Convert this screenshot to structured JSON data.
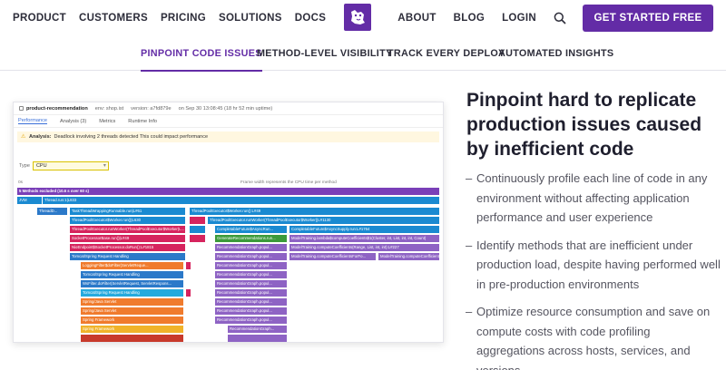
{
  "nav": {
    "left": [
      "PRODUCT",
      "CUSTOMERS",
      "PRICING",
      "SOLUTIONS",
      "DOCS"
    ],
    "right": [
      "ABOUT",
      "BLOG",
      "LOGIN"
    ],
    "cta": "GET STARTED FREE"
  },
  "tabs": [
    "PINPOINT CODE ISSUES",
    "METHOD-LEVEL VISIBILITY",
    "TRACK EVERY DEPLOY",
    "AUTOMATED INSIGHTS"
  ],
  "screenshot": {
    "service": "product-recommendation",
    "env": "env: shop.ist",
    "version": "version: a7fd879e",
    "time": "on Sep 30 13:08:45 (18 hr 52 min uptime)",
    "tabs": [
      "Performance",
      "Analysis (3)",
      "Metrics",
      "Runtime Info"
    ],
    "analysis_label": "Analysis:",
    "analysis_text": "Deadlock involving 2 threads detected This could impact performance",
    "type_label": "Type",
    "type_value": "CPU",
    "zero_label": "0s",
    "frame_note": "Frame width represents the CPU time per method",
    "frames": [
      "5 Methods excluded (10.6 s over 60 s)",
      "JVM",
      "Thread.run:1|L833",
      "ThreadD...",
      "TaskThreadWrappingRunnable.run|L#61",
      "ThreadPoolExecutor$Worker.run():L#49",
      "ThreadPoolExecutor$Worker.run()|L630",
      "ThreadPoolExecutor.runWorker(ThreadPoolExecutor$Worker)|L#1130",
      "ThreadPoolExecutor.runWorker(ThreadPoolExecutor$Worker)L...",
      "CompletableFuture$AsyncRun...",
      "CompletableFuture$AsyncSupply.run:L#1764",
      "SocketProcessorBase.run()|L#49",
      "GenerateRecommendations.run...",
      "RecommendationGraph.popul...",
      "ModelTraining.lambda$computeCoefficients$1(Cluster, int, List, int, int, Count)",
      "NioEndpoint$SocketProcessor.doRun():L#1815",
      "ModelTraining.computeCoefficients(Range, List, int, int):L#227",
      "ModelTraining.computeCoefficientsForFo...",
      "ModelTraining.computeCoefficients",
      "Tomcat/Spring Request Handling",
      "LoggingFilter$doFilter(ServletReque...",
      "Tomcat/Spring Request Handling",
      "WsFilter.doFilter(ServletRequest, ServletRespons...",
      "Tomcat/Spring Request Handling",
      "Spring/Java Servlet",
      "Spring/Java Servlet",
      "Spring Framework",
      "RecommendationGraph...",
      "Spring Framework"
    ]
  },
  "headline": "Pinpoint hard to replicate production issues caused by inefficient code",
  "bullets": [
    "Continuously profile each line of code in any environment without affecting application performance and user experience",
    "Identify methods that are inefficient under production load, despite having performed well in pre-production environments",
    "Optimize resource consumption and save on compute costs with code profiling aggregations across hosts, services, and versions"
  ]
}
